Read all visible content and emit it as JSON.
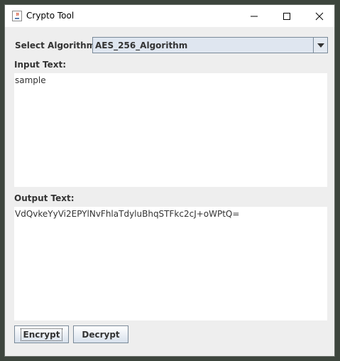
{
  "window": {
    "title": "Crypto Tool",
    "icons": {
      "app": "java-cup-icon",
      "minimize": "minimize-icon",
      "maximize": "maximize-icon",
      "close": "close-icon"
    }
  },
  "form": {
    "algorithm_label": "Select Algorithm:",
    "algorithm_value": "AES_256_Algorithm",
    "input_label": "Input Text:",
    "input_text": "sample",
    "output_label": "Output Text:",
    "output_text": "VdQvkeYyVi2EPYlNvFhlaTdyluBhqSTFkc2cJ+oWPtQ="
  },
  "buttons": {
    "encrypt": "Encrypt",
    "decrypt": "Decrypt"
  }
}
